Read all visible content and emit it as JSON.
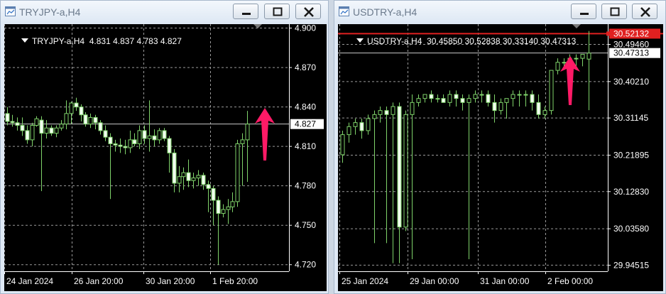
{
  "windows": [
    {
      "title": "TRYJPY-a,H4",
      "header": {
        "symbol": "TRYJPY-a,H4",
        "open": "4.831",
        "high": "4.837",
        "low": "4.783",
        "close": "4.827"
      },
      "price_labels": [
        "4.900",
        "4.870",
        "4.840",
        "4.810",
        "4.780",
        "4.750",
        "4.720"
      ],
      "current_price": "4.827",
      "time_labels": [
        "24 Jan 2024",
        "26 Jan 20:00",
        "30 Jan 20:00",
        "1 Feb 20:00"
      ]
    },
    {
      "title": "USDTRY-a,H4",
      "header": {
        "symbol": "USDTRY-a,H4",
        "open": "30.45850",
        "high": "30.52838",
        "low": "30.33140",
        "close": "30.47313"
      },
      "price_labels": [
        "30.49460",
        "30.40210",
        "30.31145",
        "30.21895",
        "30.12830",
        "30.03580",
        "29.94515"
      ],
      "current_price": "30.47313",
      "alert_price": "30.52132",
      "time_labels": [
        "25 Jan 2024",
        "29 Jan 00:00",
        "31 Jan 00:00",
        "2 Feb 00:00"
      ]
    }
  ],
  "colors": {
    "candle": "#7fd36a",
    "chart_bg": "#000000",
    "grid": "#9a9a9a",
    "alert_line": "#e02020",
    "arrow": "#ff1a66"
  },
  "icons": {
    "title": "chart-window-icon",
    "minimize": "minimize-icon",
    "maximize": "maximize-icon",
    "close": "close-icon",
    "arrow": "up-arrow-icon"
  },
  "chart_data": [
    {
      "type": "candlestick",
      "title": "TRYJPY-a,H4",
      "ylim": [
        4.715,
        4.903
      ],
      "y_ticks": [
        4.9,
        4.87,
        4.84,
        4.81,
        4.78,
        4.75,
        4.72
      ],
      "x_ticks": [
        "24 Jan 2024",
        "26 Jan 20:00",
        "30 Jan 20:00",
        "1 Feb 20:00"
      ],
      "current_price": 4.827,
      "ohlc": [
        [
          4.835,
          4.84,
          4.826,
          4.829
        ],
        [
          4.829,
          4.834,
          4.825,
          4.828
        ],
        [
          4.828,
          4.832,
          4.822,
          4.826
        ],
        [
          4.826,
          4.832,
          4.818,
          4.822
        ],
        [
          4.822,
          4.826,
          4.812,
          4.815
        ],
        [
          4.815,
          4.828,
          4.81,
          4.826
        ],
        [
          4.826,
          4.833,
          4.825,
          4.831
        ],
        [
          4.83,
          4.833,
          4.776,
          4.82
        ],
        [
          4.82,
          4.83,
          4.816,
          4.824
        ],
        [
          4.824,
          4.826,
          4.818,
          4.82
        ],
        [
          4.82,
          4.826,
          4.817,
          4.824
        ],
        [
          4.824,
          4.83,
          4.822,
          4.827
        ],
        [
          4.827,
          4.845,
          4.823,
          4.835
        ],
        [
          4.835,
          4.844,
          4.827,
          4.843
        ],
        [
          4.843,
          4.847,
          4.837,
          4.84
        ],
        [
          4.84,
          4.842,
          4.829,
          4.834
        ],
        [
          4.834,
          4.836,
          4.825,
          4.827
        ],
        [
          4.827,
          4.835,
          4.824,
          4.832
        ],
        [
          4.832,
          4.834,
          4.823,
          4.828
        ],
        [
          4.828,
          4.83,
          4.819,
          4.822
        ],
        [
          4.822,
          4.826,
          4.814,
          4.817
        ],
        [
          4.817,
          4.82,
          4.77,
          4.812
        ],
        [
          4.812,
          4.815,
          4.806,
          4.811
        ],
        [
          4.811,
          4.816,
          4.805,
          4.81
        ],
        [
          4.81,
          4.815,
          4.804,
          4.809
        ],
        [
          4.809,
          4.822,
          4.805,
          4.815
        ],
        [
          4.815,
          4.82,
          4.81,
          4.812
        ],
        [
          4.812,
          4.826,
          4.808,
          4.822
        ],
        [
          4.822,
          4.826,
          4.812,
          4.816
        ],
        [
          4.816,
          4.845,
          4.806,
          4.818
        ],
        [
          4.818,
          4.823,
          4.81,
          4.815
        ],
        [
          4.815,
          4.824,
          4.812,
          4.822
        ],
        [
          4.822,
          4.824,
          4.814,
          4.816
        ],
        [
          4.816,
          4.818,
          4.79,
          4.805
        ],
        [
          4.805,
          4.808,
          4.775,
          4.782
        ],
        [
          4.782,
          4.795,
          4.775,
          4.787
        ],
        [
          4.787,
          4.794,
          4.777,
          4.79
        ],
        [
          4.79,
          4.8,
          4.779,
          4.784
        ],
        [
          4.784,
          4.79,
          4.778,
          4.786
        ],
        [
          4.786,
          4.792,
          4.78,
          4.788
        ],
        [
          4.788,
          4.79,
          4.777,
          4.781
        ],
        [
          4.781,
          4.784,
          4.76,
          4.778
        ],
        [
          4.778,
          4.78,
          4.75,
          4.769
        ],
        [
          4.769,
          4.772,
          4.72,
          4.759
        ],
        [
          4.759,
          4.766,
          4.756,
          4.762
        ],
        [
          4.762,
          4.77,
          4.751,
          4.764
        ],
        [
          4.764,
          4.775,
          4.76,
          4.768
        ],
        [
          4.768,
          4.815,
          4.764,
          4.812
        ],
        [
          4.812,
          4.82,
          4.78,
          4.815
        ],
        [
          4.815,
          4.837,
          4.783,
          4.827
        ]
      ]
    },
    {
      "type": "candlestick",
      "title": "USDTRY-a,H4",
      "ylim": [
        29.93,
        30.545
      ],
      "y_ticks": [
        30.4946,
        30.4021,
        30.31145,
        30.21895,
        30.1283,
        30.0358,
        29.94515
      ],
      "x_ticks": [
        "25 Jan 2024",
        "29 Jan 00:00",
        "31 Jan 00:00",
        "2 Feb 00:00"
      ],
      "current_price": 30.47313,
      "alert_price": 30.52132,
      "ohlc": [
        [
          30.22,
          30.28,
          30.2,
          30.27
        ],
        [
          30.27,
          30.3,
          30.25,
          30.29
        ],
        [
          30.29,
          30.31,
          30.27,
          30.3
        ],
        [
          30.3,
          30.31,
          30.26,
          30.28
        ],
        [
          30.28,
          30.32,
          30.27,
          30.31
        ],
        [
          30.31,
          30.33,
          30.0,
          30.32
        ],
        [
          30.32,
          30.34,
          30.3,
          30.33
        ],
        [
          30.33,
          30.34,
          30.0,
          30.32
        ],
        [
          30.32,
          30.35,
          29.95,
          30.34
        ],
        [
          30.34,
          30.35,
          29.95,
          30.04
        ],
        [
          30.04,
          30.33,
          30.03,
          30.32
        ],
        [
          30.32,
          30.37,
          29.96,
          30.35
        ],
        [
          30.35,
          30.37,
          30.34,
          30.36
        ],
        [
          30.36,
          30.37,
          30.35,
          30.37
        ],
        [
          30.37,
          30.38,
          30.35,
          30.36
        ],
        [
          30.36,
          30.37,
          30.35,
          30.36
        ],
        [
          30.36,
          30.37,
          30.35,
          30.35
        ],
        [
          30.35,
          30.38,
          30.34,
          30.37
        ],
        [
          30.37,
          30.38,
          30.34,
          30.36
        ],
        [
          30.36,
          30.37,
          30.33,
          30.35
        ],
        [
          30.35,
          30.37,
          29.96,
          30.36
        ],
        [
          30.36,
          30.38,
          30.35,
          30.37
        ],
        [
          30.37,
          30.38,
          30.35,
          30.37
        ],
        [
          30.37,
          30.38,
          30.34,
          30.35
        ],
        [
          30.35,
          30.37,
          30.3,
          30.33
        ],
        [
          30.33,
          30.36,
          30.32,
          30.35
        ],
        [
          30.35,
          30.36,
          30.31,
          30.36
        ],
        [
          30.36,
          30.38,
          30.34,
          30.37
        ],
        [
          30.37,
          30.38,
          30.34,
          30.37
        ],
        [
          30.37,
          30.38,
          30.34,
          30.37
        ],
        [
          30.37,
          30.38,
          30.33,
          30.35
        ],
        [
          30.35,
          30.37,
          30.31,
          30.32
        ],
        [
          30.32,
          30.34,
          30.31,
          30.33
        ],
        [
          30.33,
          30.43,
          30.32,
          30.43
        ],
        [
          30.43,
          30.46,
          30.42,
          30.45
        ],
        [
          30.45,
          30.46,
          30.44,
          30.45
        ],
        [
          30.45,
          30.47,
          30.44,
          30.46
        ],
        [
          30.46,
          30.47,
          30.44,
          30.46
        ],
        [
          30.46,
          30.47,
          30.44,
          30.47
        ],
        [
          30.458,
          30.528,
          30.331,
          30.473
        ]
      ]
    }
  ]
}
